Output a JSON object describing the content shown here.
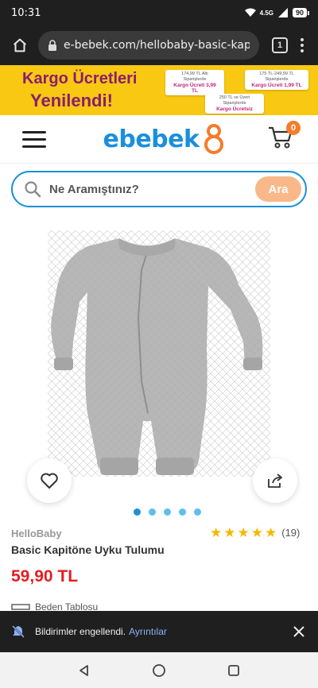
{
  "status_bar": {
    "time": "10:31",
    "network": "4.5G",
    "battery": "90"
  },
  "browser": {
    "url": "e-bebek.com/hellobaby-basic-kapitone",
    "tab_count": "1"
  },
  "banner": {
    "title_line1": "Kargo Ücretleri",
    "title_line2": "Yenilendi!",
    "promo1_text": "174,99 TL Altı Siparişlerde",
    "promo1_fee": "Kargo Ücreti 3,99 TL",
    "promo2_text": "175 TL-249,99 TL Siparişlerde",
    "promo2_fee": "Kargo Ücreti 1,99 TL",
    "promo3_text": "250 TL ve Üzeri Siparişlerde",
    "promo3_fee": "Kargo Ücretsiz"
  },
  "header": {
    "logo": "ebebek",
    "cart_count": "0"
  },
  "search": {
    "placeholder": "Ne Aramıştınız?",
    "button": "Ara"
  },
  "carousel": {
    "dot_count": 5,
    "active_index": 0
  },
  "product": {
    "brand": "HelloBaby",
    "title": "Basic Kapitöne Uyku Tulumu",
    "rating": 5,
    "review_count": "(19)",
    "price": "59,90 TL",
    "size_table_label": "Beden Tablosu"
  },
  "snackbar": {
    "text": "Bildirimler engellendi.",
    "link": "Ayrıntılar"
  },
  "colors": {
    "brand_blue": "#1a8fdc",
    "price_red": "#e31e24",
    "banner_yellow": "#f8c813",
    "cart_badge": "#f57c2b"
  }
}
